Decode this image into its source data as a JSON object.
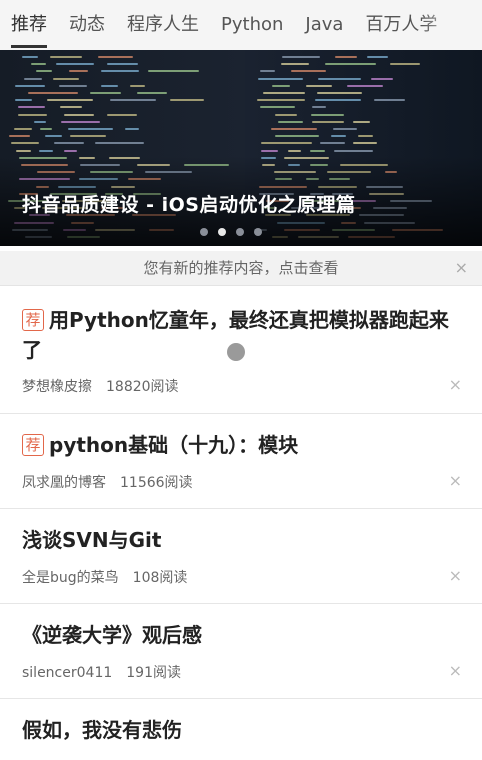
{
  "tabs": [
    "推荐",
    "动态",
    "程序人生",
    "Python",
    "Java",
    "百万人学"
  ],
  "banner": {
    "title": "抖音品质建设 - iOS启动优化之原理篇",
    "dot_count": 4,
    "active_dot": 1
  },
  "notice": {
    "text": "您有新的推荐内容，点击查看",
    "close": "×"
  },
  "articles": [
    {
      "tag": "荐",
      "title": "用Python忆童年，最终还真把模拟器跑起来了",
      "author": "梦想橡皮擦",
      "reads": "18820阅读"
    },
    {
      "tag": "荐",
      "title": "python基础（十九）：模块",
      "author": "凤求凰的博客",
      "reads": "11566阅读"
    },
    {
      "tag": "",
      "title": "浅谈SVN与Git",
      "author": "全是bug的菜鸟",
      "reads": "108阅读"
    },
    {
      "tag": "",
      "title": "《逆袭大学》观后感",
      "author": "silencer0411",
      "reads": "191阅读"
    },
    {
      "tag": "",
      "title": "假如，我没有悲伤",
      "author": "",
      "reads": ""
    }
  ],
  "close_glyph": "×"
}
